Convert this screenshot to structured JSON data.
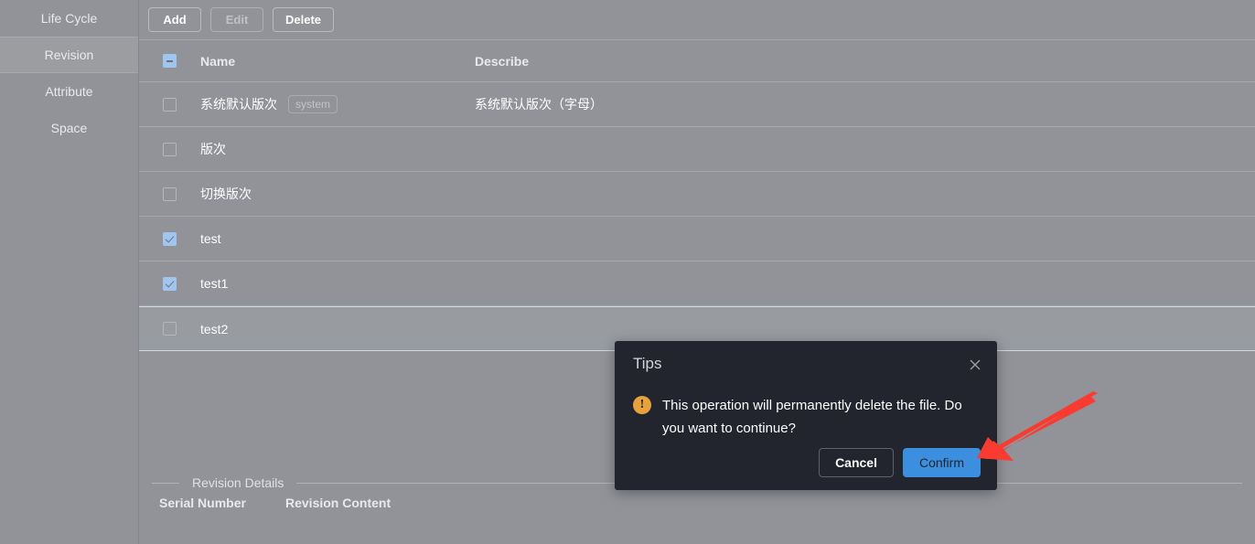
{
  "sidebar": {
    "items": [
      {
        "label": "Life Cycle",
        "active": false
      },
      {
        "label": "Revision",
        "active": true
      },
      {
        "label": "Attribute",
        "active": false
      },
      {
        "label": "Space",
        "active": false
      }
    ]
  },
  "toolbar": {
    "add_label": "Add",
    "edit_label": "Edit",
    "delete_label": "Delete"
  },
  "table": {
    "columns": {
      "name": "Name",
      "describe": "Describe"
    },
    "select_all_state": "indeterminate",
    "rows": [
      {
        "checked": false,
        "name": "系统默认版次",
        "tag": "system",
        "describe": "系统默认版次（字母）",
        "hover": false
      },
      {
        "checked": false,
        "name": "版次",
        "tag": "",
        "describe": "",
        "hover": false
      },
      {
        "checked": false,
        "name": "切换版次",
        "tag": "",
        "describe": "",
        "hover": false
      },
      {
        "checked": true,
        "name": "test",
        "tag": "",
        "describe": "",
        "hover": false
      },
      {
        "checked": true,
        "name": "test1",
        "tag": "",
        "describe": "",
        "hover": false
      },
      {
        "checked": false,
        "name": "test2",
        "tag": "",
        "describe": "",
        "hover": true
      }
    ]
  },
  "details": {
    "legend": "Revision Details",
    "col_serial": "Serial Number",
    "col_content": "Revision Content"
  },
  "dialog": {
    "title": "Tips",
    "message": "This operation will permanently delete the file. Do you want to continue?",
    "cancel_label": "Cancel",
    "confirm_label": "Confirm",
    "close_icon": "close-icon",
    "warn_icon": "!",
    "confirm_color": "#3c8ede",
    "warn_color": "#e6a23c"
  },
  "annotation": {
    "arrow_color": "#fb3b30"
  }
}
